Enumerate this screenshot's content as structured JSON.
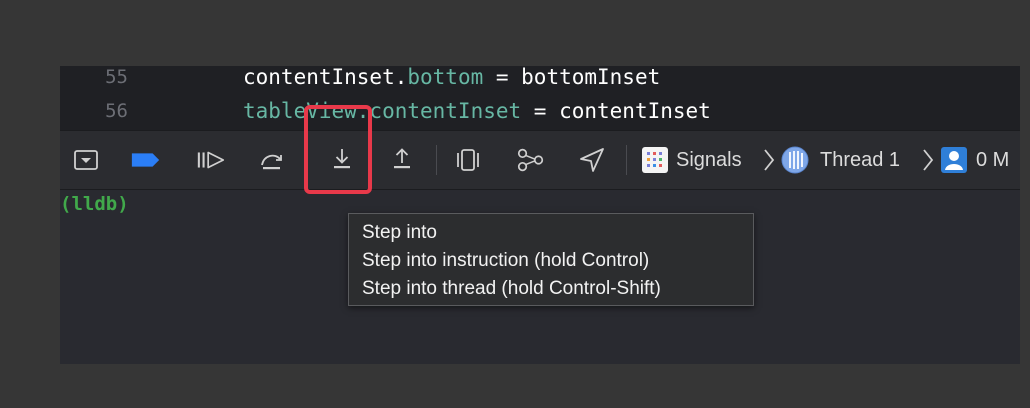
{
  "editor": {
    "lines": [
      {
        "number": "55",
        "code_prefix": "contentInset.",
        "code_prop": "bottom",
        "code_suffix": " = bottomInset"
      },
      {
        "number": "56",
        "code_prefix": "",
        "code_prop": "tableView.contentInset",
        "code_suffix": " = contentInset"
      }
    ]
  },
  "toolbar": {
    "icons": {
      "hide_debug_area": "hide-debug-area-icon",
      "breakpoints": "breakpoint-icon",
      "continue": "continue-icon",
      "step_over": "step-over-icon",
      "step_into": "step-into-icon",
      "step_out": "step-out-icon",
      "view_debugger": "view-debugger-icon",
      "memory_graph": "memory-graph-icon",
      "simulate_location": "location-icon"
    },
    "breadcrumb": {
      "app": "Signals",
      "thread": "Thread 1",
      "frame": "0 M"
    }
  },
  "console": {
    "prompt": "(lldb)"
  },
  "tooltip": {
    "lines": [
      "Step into",
      "Step into instruction (hold Control)",
      "Step into thread (hold Control-Shift)"
    ]
  },
  "colors": {
    "background": "#363636",
    "editor_bg": "#1f2024",
    "console_bg": "#292a30",
    "property_color": "#67b7a4",
    "prompt_color": "#41a94b",
    "breakpoint_blue": "#2b7ef6",
    "highlight_red": "#e8394a"
  }
}
